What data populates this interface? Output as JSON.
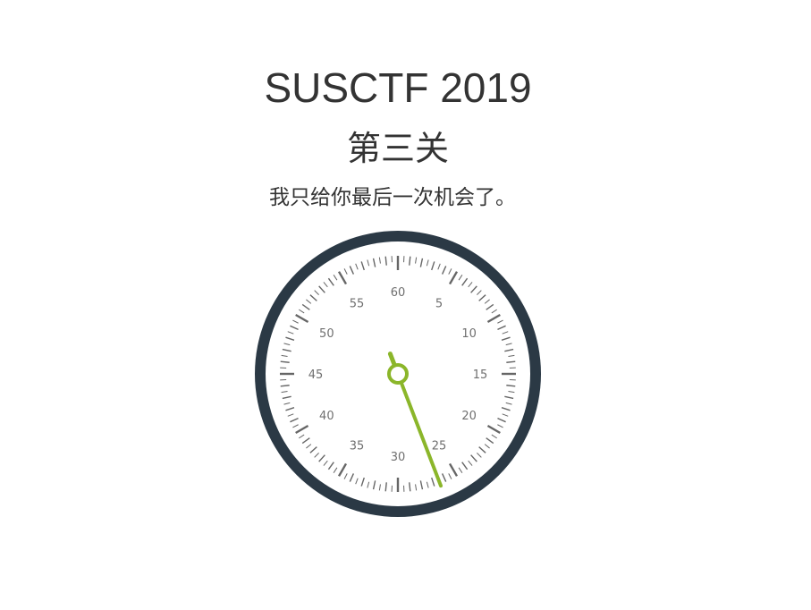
{
  "page": {
    "title": "SUSCTF 2019",
    "level": "第三关",
    "message": "我只给你最后一次机会了。"
  },
  "stopwatch": {
    "labels": [
      "60",
      "5",
      "10",
      "15",
      "20",
      "25",
      "30",
      "35",
      "40",
      "45",
      "50",
      "55"
    ],
    "seconds": 26.5,
    "colors": {
      "bezel": "#2b3945",
      "face": "#ffffff",
      "ticks": "#666666",
      "hand": "#8bb62a"
    }
  }
}
